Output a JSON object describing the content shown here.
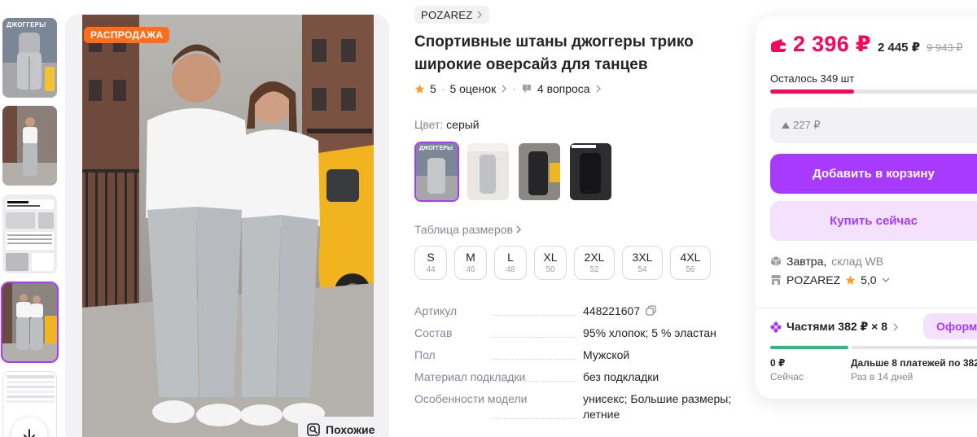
{
  "gallery": {
    "thumb_caption": "ДЖОГГЕРЫ",
    "sale_badge": "РАСПРОДАЖА",
    "similar_label": "Похожие"
  },
  "product": {
    "brand": "POZAREZ",
    "title": "Спортивные штаны джоггеры трико широкие оверсайз для танцев",
    "rating": "5",
    "reviews": "5 оценок",
    "questions": "4 вопроса",
    "color_label": "Цвет:",
    "color_value": "серый",
    "swatch_caption": "ДЖОГГЕРЫ",
    "size_table_label": "Таблица размеров",
    "sizes": [
      {
        "size": "S",
        "num": "44"
      },
      {
        "size": "M",
        "num": "46"
      },
      {
        "size": "L",
        "num": "48"
      },
      {
        "size": "XL",
        "num": "50"
      },
      {
        "size": "2XL",
        "num": "52"
      },
      {
        "size": "3XL",
        "num": "54"
      },
      {
        "size": "4XL",
        "num": "56"
      }
    ],
    "specs": [
      {
        "key": "Артикул",
        "value": "448221607"
      },
      {
        "key": "Состав",
        "value": "95% хлопок; 5 % эластан"
      },
      {
        "key": "Пол",
        "value": "Мужской"
      },
      {
        "key": "Материал подкладки",
        "value": "без подкладки"
      },
      {
        "key": "Особенности модели",
        "value": "унисекс; Большие размеры; летние"
      }
    ]
  },
  "price_card": {
    "price": "2 396 ₽",
    "price_second": "2 445 ₽",
    "price_old": "9 943 ₽",
    "stock_left": "Осталось 349 шт",
    "stock_fraction": 0.38,
    "discount": "227 ₽",
    "add_to_cart": "Добавить в корзину",
    "buy_now": "Купить сейчас",
    "delivery_when": "Завтра,",
    "delivery_where": "склад WB",
    "seller": "POZAREZ",
    "seller_rating": "5,0",
    "installments": "Частями 382 ₽ × 8",
    "installments_button": "Оформ",
    "pay_now_amount": "0 ₽",
    "pay_now_label": "Сейчас",
    "pay_later_amount": "Дальше 8 платежей по 382",
    "pay_later_label": "Раз в 14 дней"
  },
  "colors": {
    "accent": "#a73afd",
    "price": "#f5085c",
    "sale": "#ff6d1a",
    "progress": "#1dc480"
  }
}
